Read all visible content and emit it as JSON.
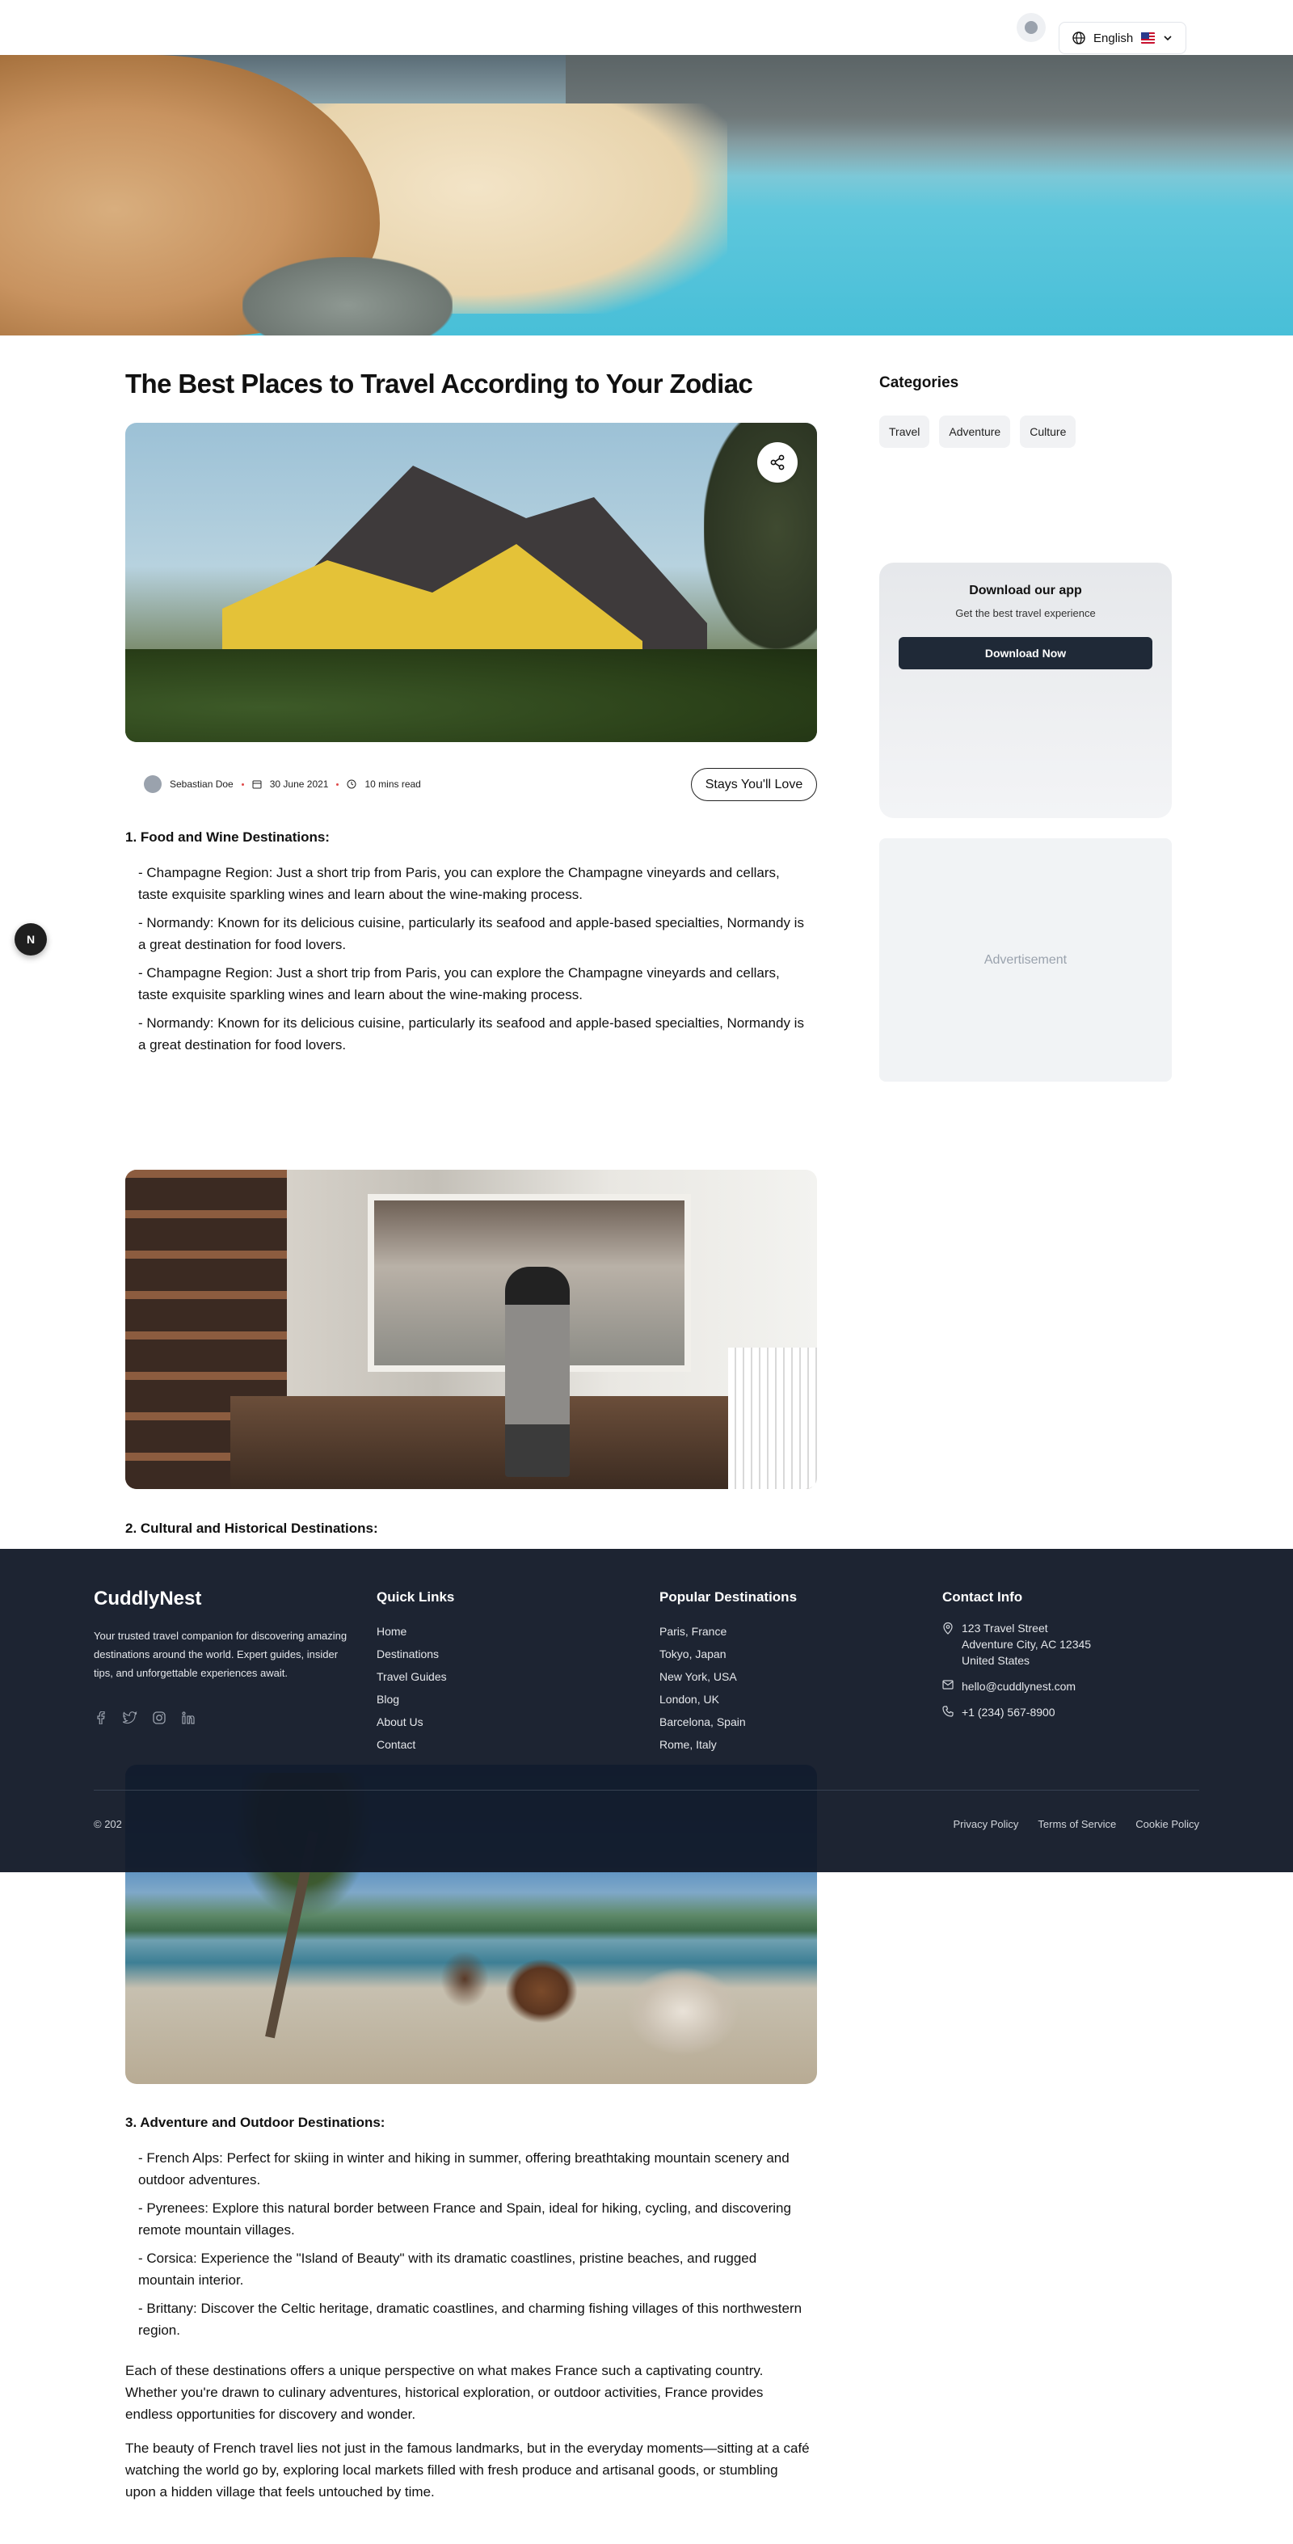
{
  "topbar": {
    "language_label": "English",
    "language_icon": "globe-icon",
    "flag_icon": "us-flag-icon"
  },
  "article": {
    "title": "The Best Places to Travel According to Your Zodiac",
    "author": "Sebastian Doe",
    "date": "30 June 2021",
    "read_time": "10 mins read",
    "tag_button": "Stays You'll Love",
    "sections": [
      {
        "heading": "1. Food and Wine Destinations:",
        "items": [
          "- Champagne Region: Just a short trip from Paris, you can explore the Champagne vineyards and cellars, taste exquisite sparkling wines and learn about the wine-making process.",
          "- Normandy: Known for its delicious cuisine, particularly its seafood and apple-based specialties, Normandy is a great destination for food lovers.",
          "- Champagne Region: Just a short trip from Paris, you can explore the Champagne vineyards and cellars, taste exquisite sparkling wines and learn about the wine-making process.",
          "- Normandy: Known for its delicious cuisine, particularly its seafood and apple-based specialties, Normandy is a great destination for food lovers."
        ]
      },
      {
        "heading": "2. Cultural and Historical Destinations:",
        "items": []
      },
      {
        "heading": "3. Adventure and Outdoor Destinations:",
        "items": [
          "- French Alps: Perfect for skiing in winter and hiking in summer, offering breathtaking mountain scenery and outdoor adventures.",
          "- Pyrenees: Explore this natural border between France and Spain, ideal for hiking, cycling, and discovering remote mountain villages.",
          "- Corsica: Experience the \"Island of Beauty\" with its dramatic coastlines, pristine beaches, and rugged mountain interior.",
          "- Brittany: Discover the Celtic heritage, dramatic coastlines, and charming fishing villages of this northwestern region."
        ]
      }
    ],
    "closing": [
      "Each of these destinations offers a unique perspective on what makes France such a captivating country. Whether you're drawn to culinary adventures, historical exploration, or outdoor activities, France provides endless opportunities for discovery and wonder.",
      "The beauty of French travel lies not just in the famous landmarks, but in the everyday moments—sitting at a café watching the world go by, exploring local markets filled with fresh produce and artisanal goods, or stumbling upon a hidden village that feels untouched by time."
    ]
  },
  "sidebar": {
    "categories_title": "Categories",
    "categories": [
      "Travel",
      "Adventure",
      "Culture"
    ],
    "app_title": "Download our app",
    "app_subtitle": "Get the best travel experience",
    "app_button": "Download Now",
    "ad_label": "Advertisement"
  },
  "fab_label": "N",
  "footer": {
    "brand": "CuddlyNest",
    "description": "Your trusted travel companion for discovering amazing destinations around the world. Expert guides, insider tips, and unforgettable experiences await.",
    "social_icons": [
      "facebook-icon",
      "twitter-icon",
      "instagram-icon",
      "linkedin-icon"
    ],
    "quick_links_title": "Quick Links",
    "quick_links": [
      "Home",
      "Destinations",
      "Travel Guides",
      "Blog",
      "About Us",
      "Contact"
    ],
    "popular_title": "Popular Destinations",
    "popular": [
      "Paris, France",
      "Tokyo, Japan",
      "New York, USA",
      "London, UK",
      "Barcelona, Spain",
      "Rome, Italy"
    ],
    "contact_title": "Contact Info",
    "address_lines": [
      "123 Travel Street",
      "Adventure City, AC 12345",
      "United States"
    ],
    "email": "hello@cuddlynest.com",
    "phone": "+1 (234) 567-8900",
    "copyright": "© 202",
    "legal": [
      "Privacy Policy",
      "Terms of Service",
      "Cookie Policy"
    ]
  }
}
